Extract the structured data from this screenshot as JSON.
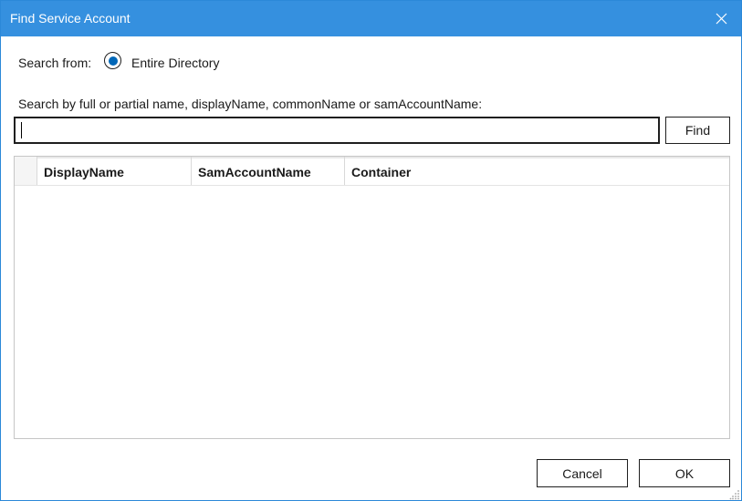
{
  "window": {
    "title": "Find Service Account"
  },
  "search_from": {
    "label": "Search from:",
    "option_label": "Entire Directory",
    "selected": true
  },
  "search": {
    "hint": "Search by full or partial name, displayName, commonName or samAccountName:",
    "value": "",
    "find_label": "Find"
  },
  "grid": {
    "columns": [
      "DisplayName",
      "SamAccountName",
      "Container"
    ],
    "rows": []
  },
  "footer": {
    "cancel_label": "Cancel",
    "ok_label": "OK"
  },
  "colors": {
    "titlebar": "#3590df",
    "radio_accent": "#0067b8"
  },
  "icons": {
    "close": "close-icon",
    "resize": "resize-grip-icon"
  }
}
